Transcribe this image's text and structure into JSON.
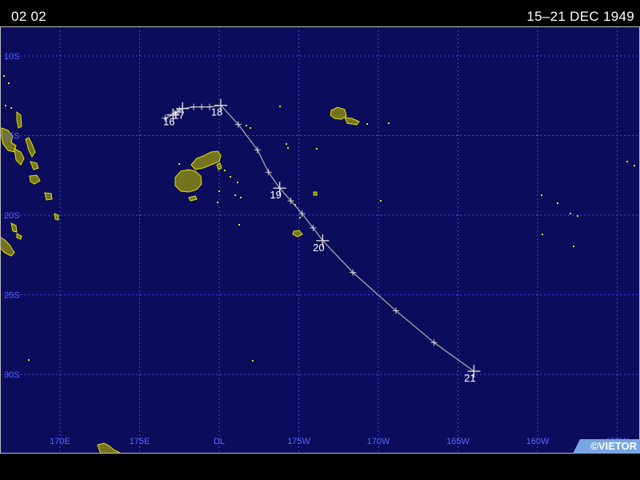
{
  "header": {
    "frame": "02 02",
    "dates": "15–21 DEC 1949"
  },
  "map": {
    "lat_lines": [
      {
        "lat": -10,
        "label": "10S"
      },
      {
        "lat": -15,
        "label": "15S"
      },
      {
        "lat": -20,
        "label": "20S"
      },
      {
        "lat": -25,
        "label": "25S"
      },
      {
        "lat": -30,
        "label": "30S"
      }
    ],
    "lon_lines": [
      {
        "lon": 170,
        "label": "170E"
      },
      {
        "lon": 175,
        "label": "175E"
      },
      {
        "lon": 180,
        "label": "DL"
      },
      {
        "lon": -175,
        "label": "175W"
      },
      {
        "lon": -170,
        "label": "170W"
      },
      {
        "lon": -165,
        "label": "165W"
      },
      {
        "lon": -160,
        "label": "160W"
      },
      {
        "lon": -155,
        "label": "155W"
      }
    ],
    "track": [
      {
        "lat": -13.9,
        "lon": 176.6
      },
      {
        "lat": -13.7,
        "lon": 177.1,
        "label": "16"
      },
      {
        "lat": -13.6,
        "lon": 177.2
      },
      {
        "lat": -13.5,
        "lon": 177.4
      },
      {
        "lat": -13.4,
        "lon": 177.5
      },
      {
        "lat": -13.3,
        "lon": 177.7,
        "label": "17"
      },
      {
        "lat": -13.2,
        "lon": 178.4
      },
      {
        "lat": -13.2,
        "lon": 178.9
      },
      {
        "lat": -13.2,
        "lon": 179.4
      },
      {
        "lat": -13.1,
        "lon": -179.9,
        "label": "18"
      },
      {
        "lat": -14.3,
        "lon": -178.8
      },
      {
        "lat": -15.9,
        "lon": -177.6
      },
      {
        "lat": -17.3,
        "lon": -176.9
      },
      {
        "lat": -18.3,
        "lon": -176.2,
        "label": "19"
      },
      {
        "lat": -19.1,
        "lon": -175.5
      },
      {
        "lat": -19.9,
        "lon": -174.8
      },
      {
        "lat": -20.8,
        "lon": -174.1
      },
      {
        "lat": -21.6,
        "lon": -173.5,
        "label": "20"
      },
      {
        "lat": -23.6,
        "lon": -171.6
      },
      {
        "lat": -26.0,
        "lon": -168.9
      },
      {
        "lat": -28.0,
        "lon": -166.5
      },
      {
        "lat": -29.8,
        "lon": -164.0,
        "label": "21"
      }
    ],
    "colors": {
      "ocean": "#0c0c5c",
      "frame": "#bdbdbd",
      "grid": "#3a4cef",
      "grid_label": "#5468f6",
      "land_fill": "#74741e",
      "land_outline": "#e4e400",
      "track_line": "#a6a6a6",
      "track_marker": "#d8d8d8",
      "track_label": "#ffffff"
    }
  },
  "badge": {
    "text": "©VIETOR",
    "color": "#78a6e0"
  }
}
